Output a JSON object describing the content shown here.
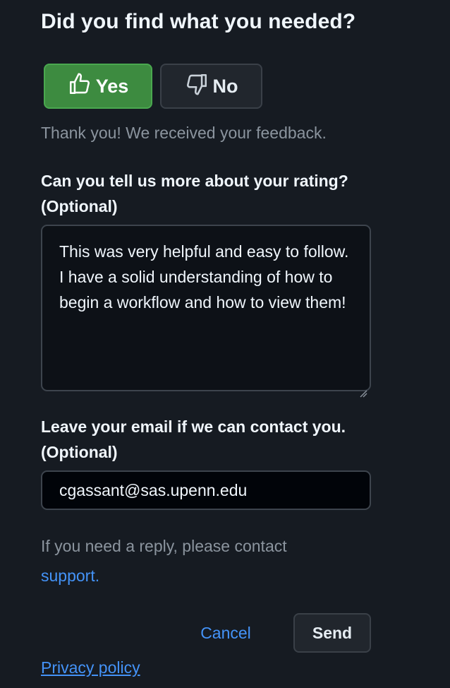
{
  "feedback": {
    "question": "Did you find what you needed?",
    "yes_label": "Yes",
    "no_label": "No",
    "yes_icon": "thumbs-up-icon",
    "no_icon": "thumbs-down-icon",
    "thanks_message": "Thank you! We received your feedback."
  },
  "rating_details": {
    "label_line1": "Can you tell us more about your rating?",
    "label_line2": "(Optional)",
    "value": "This was very helpful and easy to follow. I have a solid understanding of how to begin a workflow and how to view them!"
  },
  "email": {
    "label_line1": "Leave your email if we can contact you.",
    "label_line2": "(Optional)",
    "value": "cgassant@sas.upenn.edu"
  },
  "reply": {
    "text": "If you need a reply, please contact",
    "link_label": "support."
  },
  "actions": {
    "cancel_label": "Cancel",
    "send_label": "Send"
  },
  "footer": {
    "privacy_label": "Privacy policy"
  },
  "colors": {
    "background": "#161b22",
    "yes_button": "#3d8b40",
    "link": "#4493f8",
    "muted_text": "#8b949e"
  }
}
